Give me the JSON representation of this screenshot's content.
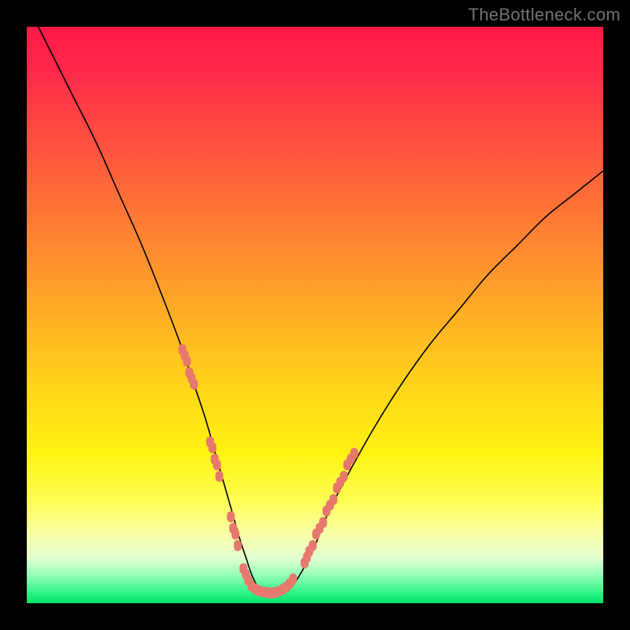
{
  "watermark": "TheBottleneck.com",
  "colors": {
    "frame": "#000000",
    "curve": "#000000",
    "markers": "#e7786e",
    "gradient_top": "#ff1848",
    "gradient_bottom": "#00e46a"
  },
  "chart_data": {
    "type": "line",
    "title": "",
    "xlabel": "",
    "ylabel": "",
    "xlim": [
      0,
      100
    ],
    "ylim": [
      0,
      100
    ],
    "grid": false,
    "legend": false,
    "annotations": [
      "TheBottleneck.com"
    ],
    "series": [
      {
        "name": "bottleneck-curve",
        "x": [
          2,
          5,
          8,
          12,
          16,
          20,
          24,
          27,
          29,
          31,
          33,
          35,
          37,
          38,
          39,
          40,
          41,
          42,
          44,
          46,
          48,
          50,
          52,
          55,
          60,
          65,
          70,
          75,
          80,
          85,
          90,
          95,
          100
        ],
        "y": [
          100,
          94,
          88,
          80,
          71,
          62,
          52,
          44,
          38,
          32,
          25,
          18,
          11,
          8,
          5,
          3,
          2,
          2,
          2,
          3,
          6,
          10,
          15,
          21,
          30,
          38,
          45,
          51,
          57,
          62,
          67,
          71,
          75
        ]
      }
    ],
    "markers": [
      {
        "x": 27.0,
        "y": 44
      },
      {
        "x": 27.4,
        "y": 43
      },
      {
        "x": 27.8,
        "y": 42
      },
      {
        "x": 28.2,
        "y": 40
      },
      {
        "x": 28.6,
        "y": 39
      },
      {
        "x": 29.0,
        "y": 38
      },
      {
        "x": 31.8,
        "y": 28
      },
      {
        "x": 32.2,
        "y": 27
      },
      {
        "x": 32.6,
        "y": 25
      },
      {
        "x": 33.0,
        "y": 24
      },
      {
        "x": 33.4,
        "y": 22
      },
      {
        "x": 35.4,
        "y": 15
      },
      {
        "x": 35.8,
        "y": 13
      },
      {
        "x": 36.2,
        "y": 12
      },
      {
        "x": 36.6,
        "y": 10
      },
      {
        "x": 37.6,
        "y": 6
      },
      {
        "x": 38.0,
        "y": 5
      },
      {
        "x": 38.4,
        "y": 4
      },
      {
        "x": 39.0,
        "y": 3
      },
      {
        "x": 39.6,
        "y": 2.5
      },
      {
        "x": 40.2,
        "y": 2.2
      },
      {
        "x": 40.8,
        "y": 2.0
      },
      {
        "x": 41.4,
        "y": 1.9
      },
      {
        "x": 42.0,
        "y": 1.8
      },
      {
        "x": 42.6,
        "y": 1.8
      },
      {
        "x": 43.2,
        "y": 1.9
      },
      {
        "x": 43.8,
        "y": 2.1
      },
      {
        "x": 44.4,
        "y": 2.4
      },
      {
        "x": 45.0,
        "y": 2.8
      },
      {
        "x": 45.6,
        "y": 3.4
      },
      {
        "x": 46.2,
        "y": 4.2
      },
      {
        "x": 48.2,
        "y": 7
      },
      {
        "x": 48.6,
        "y": 8
      },
      {
        "x": 49.0,
        "y": 9
      },
      {
        "x": 49.6,
        "y": 10
      },
      {
        "x": 50.2,
        "y": 12
      },
      {
        "x": 50.8,
        "y": 13
      },
      {
        "x": 51.4,
        "y": 14
      },
      {
        "x": 52.0,
        "y": 16
      },
      {
        "x": 52.6,
        "y": 17
      },
      {
        "x": 53.2,
        "y": 18
      },
      {
        "x": 53.8,
        "y": 20
      },
      {
        "x": 54.4,
        "y": 21
      },
      {
        "x": 55.0,
        "y": 22
      },
      {
        "x": 55.6,
        "y": 24
      },
      {
        "x": 56.2,
        "y": 25
      },
      {
        "x": 56.8,
        "y": 26
      }
    ]
  }
}
